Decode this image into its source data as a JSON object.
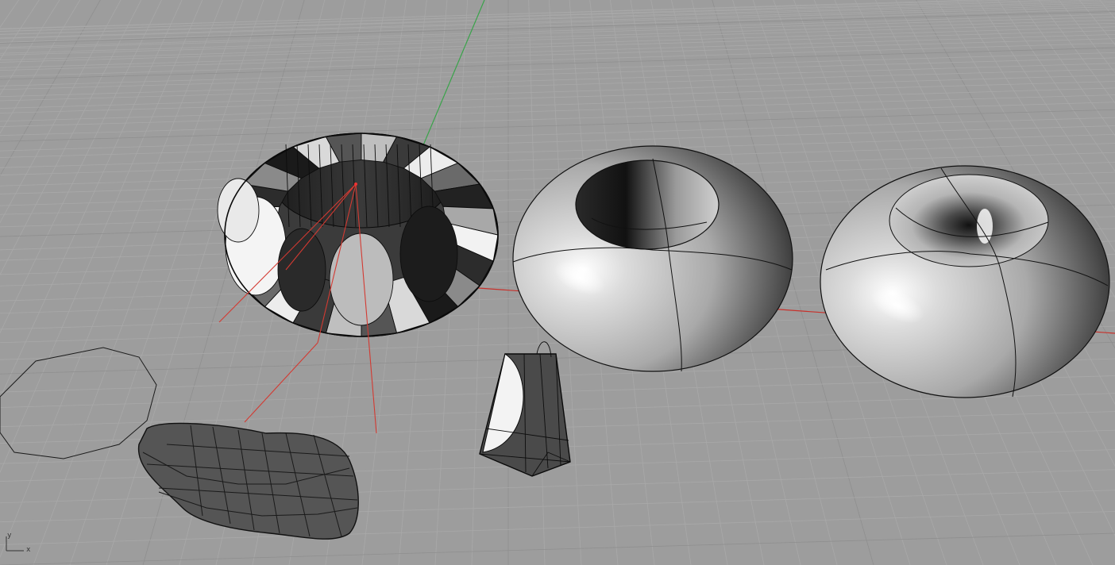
{
  "viewport": {
    "name": "Perspective",
    "background": "#9d9d9d",
    "grid_minor_color": "#a9a9a9",
    "grid_major_color": "#8f8f8f",
    "x_axis_color": "#c8312b",
    "y_axis_color": "#3aa34a"
  },
  "axis_widget": {
    "x": "x",
    "y": "y"
  },
  "objects": [
    {
      "name": "faceted-ring",
      "kind": "polysurface",
      "selected": true
    },
    {
      "name": "torus",
      "kind": "surface"
    },
    {
      "name": "horn-torus",
      "kind": "surface"
    },
    {
      "name": "faceted-wedge",
      "kind": "polysurface"
    },
    {
      "name": "decagon-curve",
      "kind": "curve"
    },
    {
      "name": "flat-blob",
      "kind": "polysurface"
    }
  ]
}
